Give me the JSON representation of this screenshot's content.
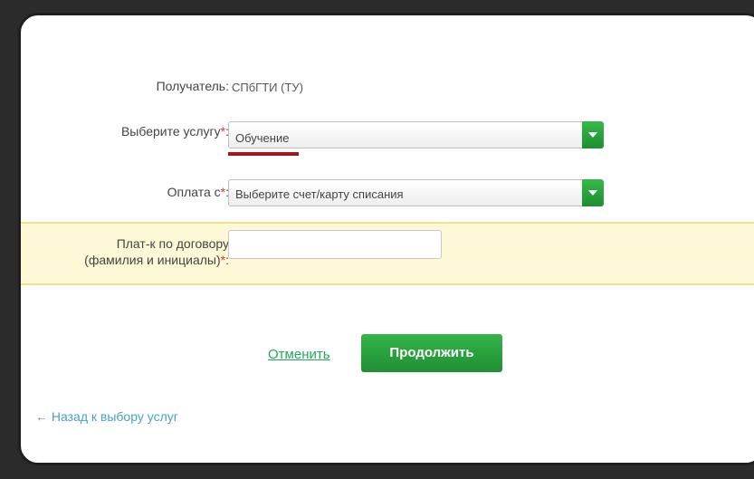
{
  "form": {
    "recipient": {
      "label": "Получатель:",
      "value": "СПбГТИ (ТУ)"
    },
    "service": {
      "label": "Выберите услугу",
      "required_mark": "*",
      "colon": ":",
      "selected": "Обучение"
    },
    "pay_from": {
      "label": "Оплата с",
      "required_mark": "*",
      "colon": ":",
      "selected": "Выберите счет/карту списания"
    },
    "payer": {
      "label_line1": "Плат-к по договору",
      "label_line2": "(фамилия и инициалы)",
      "required_mark": "*",
      "colon": ":",
      "value": ""
    }
  },
  "actions": {
    "cancel_label": "Отменить",
    "continue_label": "Продолжить"
  },
  "nav": {
    "back_arrow": "←",
    "back_label": "Назад к выбору услуг"
  },
  "colors": {
    "accent_green": "#2aa043",
    "required_red": "#e0332b",
    "highlight_bg": "#fdf8d6",
    "underline_red": "#a3161c"
  }
}
